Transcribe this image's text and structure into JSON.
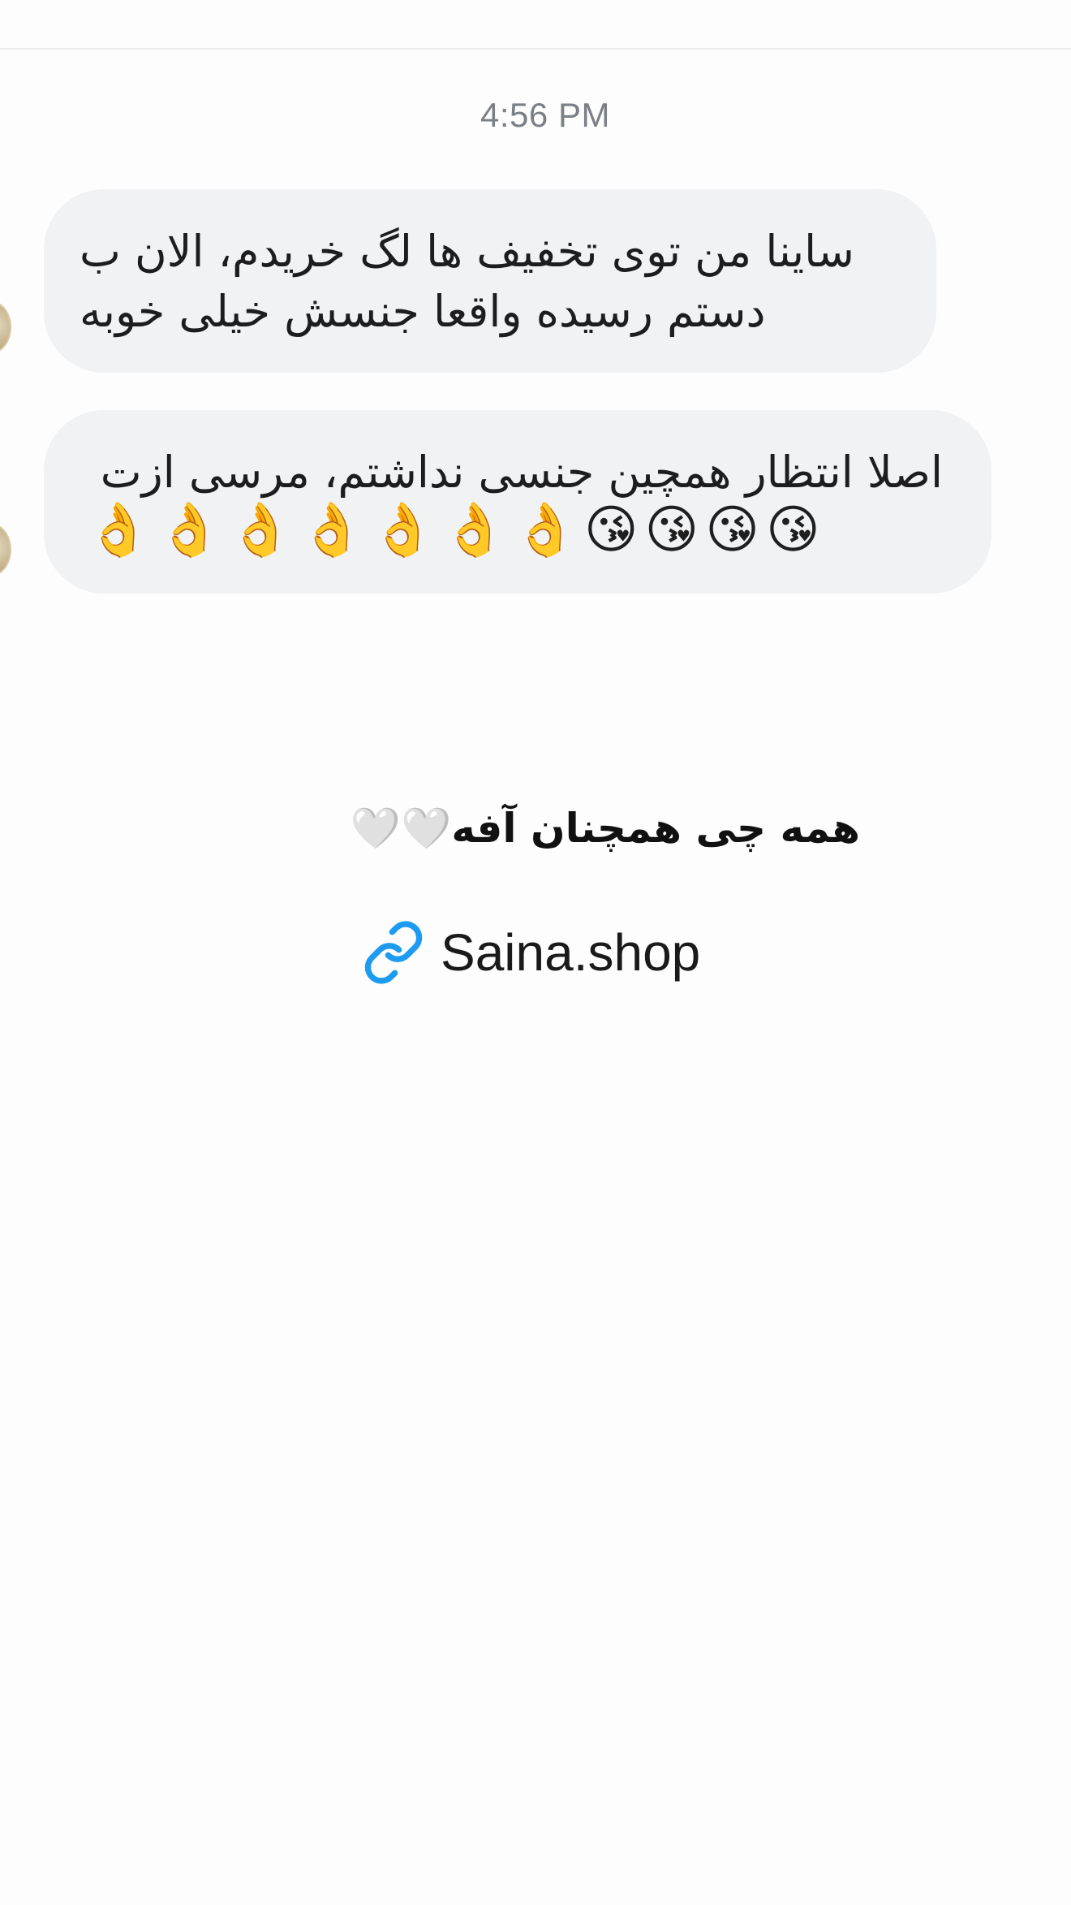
{
  "conversation": {
    "timestamp": "4:56 PM",
    "messages": [
      {
        "text": "ساینا من توی تخفیف ها لگ خریدم، الان ب\nدستم رسیده واقعا جنسش خیلی خوبه"
      },
      {
        "text": "اصلا انتظار همچین جنسی نداشتم، مرسی ازت",
        "emojis": "👌👌👌👌👌👌👌😘😘😘😘"
      }
    ]
  },
  "caption": {
    "text": "همه چی همچنان آفه🤍🤍"
  },
  "link": {
    "icon": "link-icon",
    "label": "Saina.shop",
    "icon_color": "#1d9bf0"
  }
}
